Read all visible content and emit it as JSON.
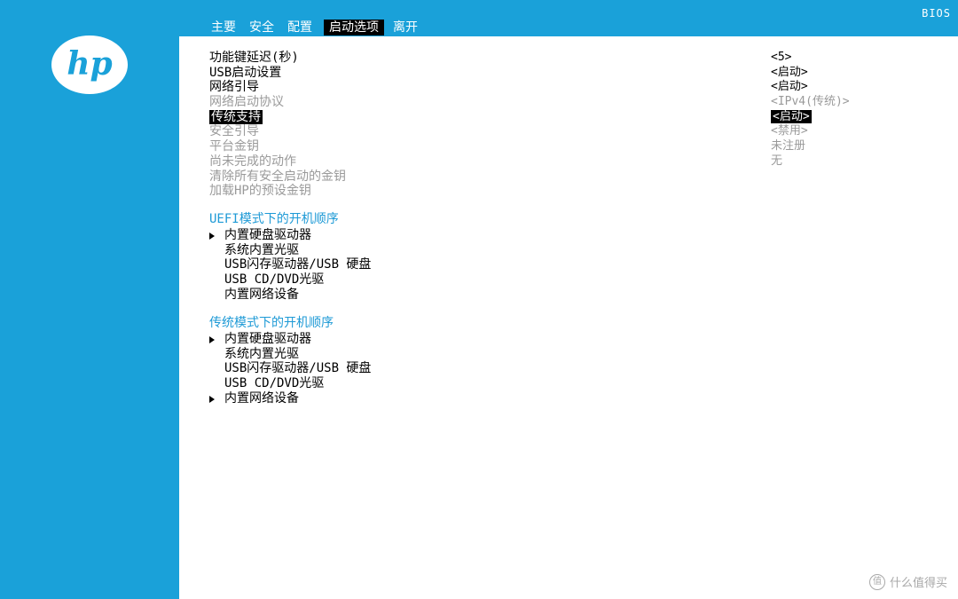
{
  "header": {
    "bios_label": "BIOS",
    "tabs": [
      {
        "label": "主要",
        "active": false
      },
      {
        "label": "安全",
        "active": false
      },
      {
        "label": "配置",
        "active": false
      },
      {
        "label": "启动选项",
        "active": true
      },
      {
        "label": "离开",
        "active": false
      }
    ]
  },
  "logo": {
    "text": "hp"
  },
  "settings": [
    {
      "label": "功能键延迟(秒)",
      "value": "<5>",
      "state": "enabled"
    },
    {
      "label": "USB启动设置",
      "value": "<启动>",
      "state": "enabled"
    },
    {
      "label": "网络引导",
      "value": "<启动>",
      "state": "enabled"
    },
    {
      "label": "网络启动协议",
      "value": "<IPv4(传统)>",
      "state": "disabled"
    },
    {
      "label": "传统支持",
      "value": "<启动>",
      "state": "selected"
    },
    {
      "label": "安全引导",
      "value": "<禁用>",
      "state": "disabled"
    },
    {
      "label": "平台金钥",
      "value": "未注册",
      "state": "disabled"
    },
    {
      "label": "尚未完成的动作",
      "value": "无",
      "state": "disabled"
    },
    {
      "label": "清除所有安全启动的金钥",
      "value": "",
      "state": "disabled"
    },
    {
      "label": "加载HP的预设金钥",
      "value": "",
      "state": "disabled"
    }
  ],
  "uefi_boot": {
    "title": "UEFI模式下的开机顺序",
    "items": [
      {
        "label": "内置硬盘驱动器",
        "arrow": true
      },
      {
        "label": "系统内置光驱",
        "arrow": false
      },
      {
        "label": "USB闪存驱动器/USB 硬盘",
        "arrow": false
      },
      {
        "label": "USB CD/DVD光驱",
        "arrow": false
      },
      {
        "label": "内置网络设备",
        "arrow": false
      }
    ]
  },
  "legacy_boot": {
    "title": "传统模式下的开机顺序",
    "items": [
      {
        "label": "内置硬盘驱动器",
        "arrow": true
      },
      {
        "label": "系统内置光驱",
        "arrow": false
      },
      {
        "label": "USB闪存驱动器/USB 硬盘",
        "arrow": false
      },
      {
        "label": "USB CD/DVD光驱",
        "arrow": false
      },
      {
        "label": "内置网络设备",
        "arrow": true
      }
    ]
  },
  "watermark": {
    "icon": "值",
    "text": "什么值得买"
  },
  "colors": {
    "accent": "#1aa1d9",
    "section_title": "#1e9ad6",
    "disabled": "#9a9a9a"
  }
}
